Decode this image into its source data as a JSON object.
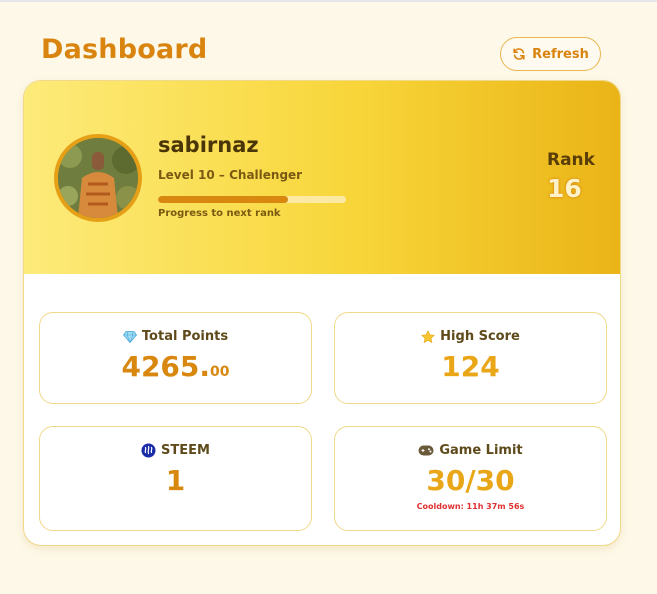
{
  "page": {
    "title": "Dashboard"
  },
  "toolbar": {
    "refresh_label": "Refresh",
    "refresh_icon": "refresh-icon"
  },
  "profile": {
    "username": "sabirnaz",
    "level_text": "Level 10 – Challenger",
    "progress_label": "Progress to next rank",
    "progress_fraction": 0.69,
    "rank_label": "Rank",
    "rank_value": "16"
  },
  "stats": {
    "total_points": {
      "icon": "gem-icon",
      "label": "Total Points",
      "value_main": "4265.",
      "value_decimal": "00"
    },
    "high_score": {
      "icon": "star-icon",
      "label": "High Score",
      "value": "124"
    },
    "steem": {
      "icon": "steem-icon",
      "label": "STEEM",
      "value": "1"
    },
    "game_limit": {
      "icon": "gamepad-icon",
      "label": "Game Limit",
      "value": "30/30",
      "cooldown": "Cooldown: 11h 37m 56s"
    }
  },
  "colors": {
    "accent": "#d9840f",
    "points": "#d9880f",
    "score": "#e9a617",
    "cooldown": "#e03030"
  }
}
